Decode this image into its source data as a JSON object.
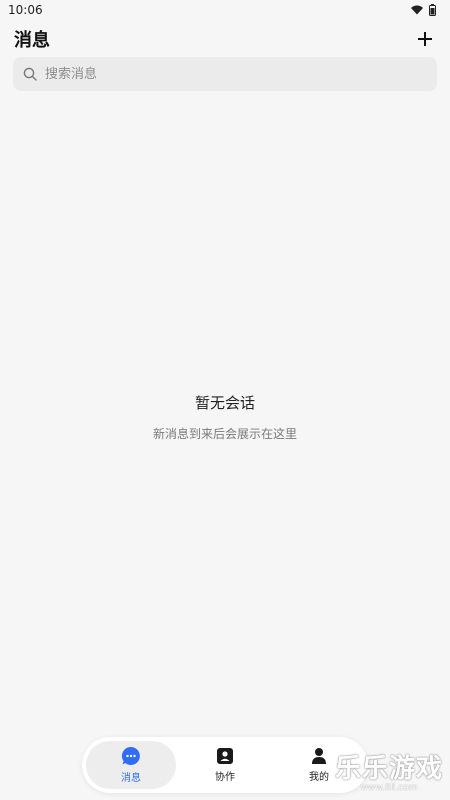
{
  "status_bar": {
    "time": "10:06"
  },
  "header": {
    "title": "消息"
  },
  "search": {
    "placeholder": "搜索消息"
  },
  "empty_state": {
    "title": "暂无会话",
    "subtitle": "新消息到来后会展示在这里"
  },
  "tabs": [
    {
      "label": "消息",
      "icon": "chat-bubble-icon",
      "active": true
    },
    {
      "label": "协作",
      "icon": "contact-card-icon",
      "active": false
    },
    {
      "label": "我的",
      "icon": "person-icon",
      "active": false
    }
  ],
  "watermark": {
    "text": "乐乐游戏",
    "url": "www.6ll.com"
  },
  "colors": {
    "accent": "#2f6df6",
    "background": "#f6f6f6",
    "search_bg": "#ebebeb"
  }
}
